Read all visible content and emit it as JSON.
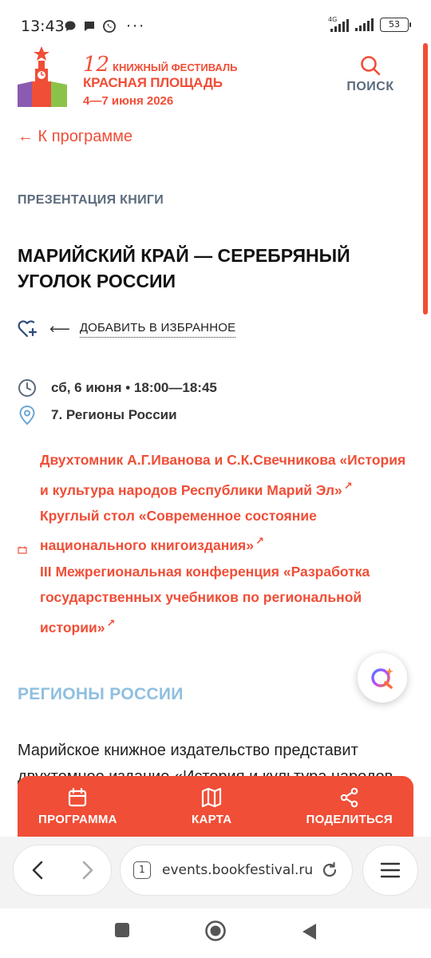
{
  "status": {
    "time": "13:43",
    "dots": "···",
    "network": "4G",
    "battery": "53"
  },
  "header": {
    "festival_number": "12",
    "festival_name": "КНИЖНЫЙ ФЕСТИВАЛЬ",
    "festival_place": "КРАСНАЯ ПЛОЩАДЬ",
    "festival_dates": "4—7 июня 2026",
    "search_label": "ПОИСК"
  },
  "nav": {
    "back_label": "← К программе"
  },
  "event": {
    "category": "ПРЕЗЕНТАЦИЯ КНИГИ",
    "title": "МАРИЙСКИЙ КРАЙ — СЕРЕБРЯНЫЙ УГОЛОК РОССИИ",
    "favorite_arrow": "⟵",
    "favorite_label": "ДОБАВИТЬ В ИЗБРАННОЕ",
    "datetime": "сб, 6 июня • 18:00—18:45",
    "location": "7. Регионы России"
  },
  "related": [
    {
      "label": "Двухтомник А.Г.Иванова и С.К.Свечникова «История и культура народов Республики Марий Эл»"
    },
    {
      "label": "Круглый стол «Современное состояние национального книгоиздания»"
    },
    {
      "label": "III Межрегиональная конференция «Разработка государственных учебников по региональной истории»"
    }
  ],
  "section": {
    "heading": "РЕГИОНЫ РОССИИ",
    "description": "Марийское книжное издательство представит двухтомное издание «История и культура народов Республики Марий Эл»"
  },
  "bottom_nav": {
    "program": "ПРОГРАММА",
    "map": "КАРТА",
    "share": "ПОДЕЛИТЬСЯ"
  },
  "browser": {
    "url": "events.bookfestival.ru",
    "tab_count": "1"
  },
  "colors": {
    "accent": "#f04e37",
    "muted": "#5b6b7c",
    "section_blue": "#8fbfe0"
  }
}
